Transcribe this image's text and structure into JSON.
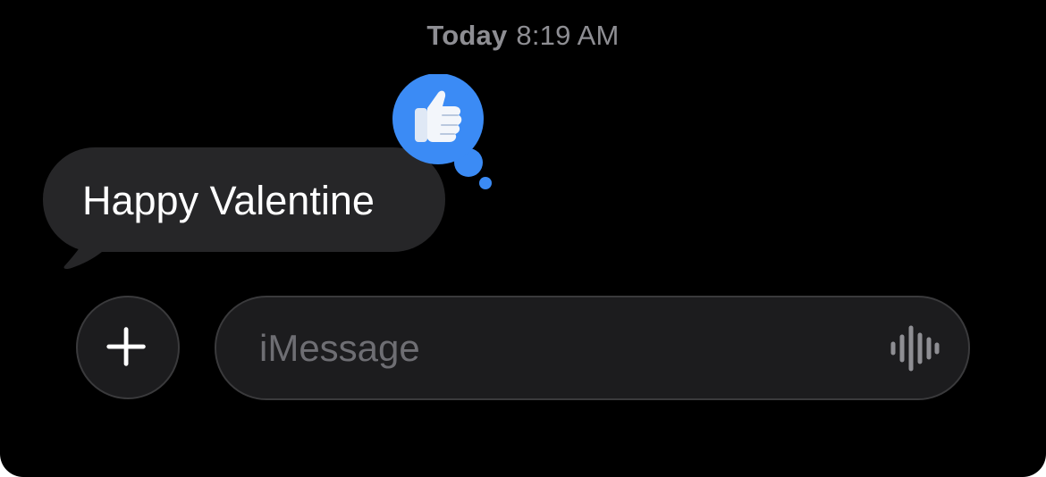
{
  "header": {
    "timestamp_day": "Today",
    "timestamp_time": "8:19 AM"
  },
  "conversation": {
    "messages": [
      {
        "direction": "incoming",
        "text": "Happy Valentine",
        "tapback": {
          "icon": "thumbs-up-icon",
          "color": "#3b8bf5"
        }
      }
    ]
  },
  "composer": {
    "add_icon": "plus-icon",
    "placeholder": "iMessage",
    "voice_icon": "waveform-icon"
  },
  "colors": {
    "background": "#000000",
    "incoming_bubble": "#262628",
    "accent_blue": "#3b8bf5",
    "secondary_text": "#8e8e93",
    "placeholder_text": "#6e6e73"
  }
}
